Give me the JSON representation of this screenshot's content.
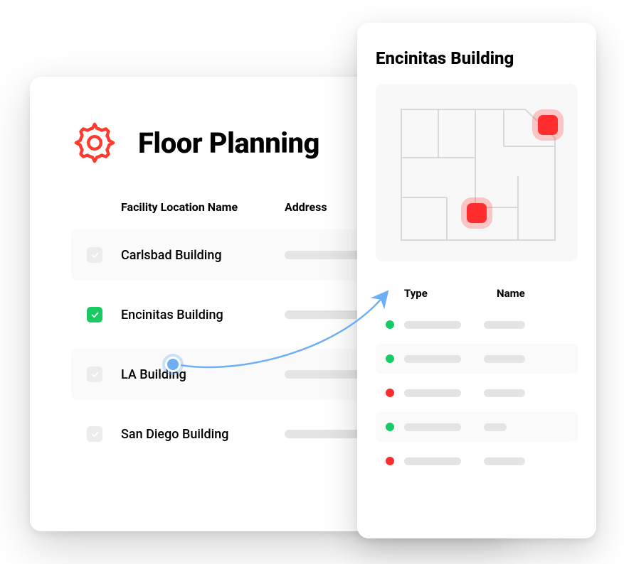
{
  "main": {
    "title": "Floor Planning",
    "columns": {
      "name": "Facility Location Name",
      "address": "Address"
    },
    "facilities": [
      {
        "name": "Carlsbad Building",
        "checked": false
      },
      {
        "name": "Encinitas Building",
        "checked": true
      },
      {
        "name": "LA Building",
        "checked": false
      },
      {
        "name": "San Diego Building",
        "checked": false
      }
    ]
  },
  "detail": {
    "title": "Encinitas Building",
    "columns": {
      "type": "Type",
      "name": "Name"
    },
    "rows": [
      {
        "status": "green",
        "shade": false,
        "short": false
      },
      {
        "status": "green",
        "shade": true,
        "short": false
      },
      {
        "status": "red",
        "shade": false,
        "short": false
      },
      {
        "status": "green",
        "shade": true,
        "short": true
      },
      {
        "status": "red",
        "shade": false,
        "short": false
      }
    ]
  }
}
